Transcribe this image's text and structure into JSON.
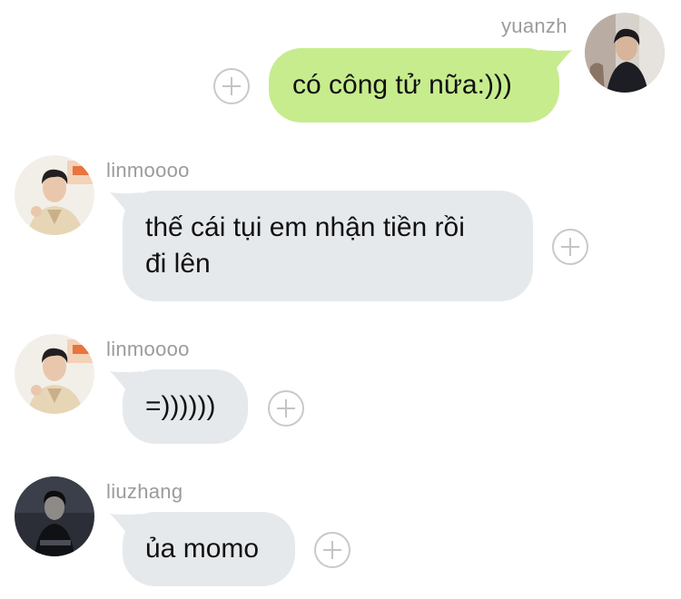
{
  "messages": [
    {
      "sender": "yuanzh",
      "text": "có công tử nữa:)))",
      "side": "right",
      "avatar": "avatar-yuanzh"
    },
    {
      "sender": "linmoooo",
      "text_line1": "thế cái tụi em nhận tiền rồi",
      "text_line2": "đi lên",
      "side": "left",
      "avatar": "avatar-linmoooo"
    },
    {
      "sender": "linmoooo",
      "text": "=))))))",
      "side": "left",
      "avatar": "avatar-linmoooo"
    },
    {
      "sender": "liuzhang",
      "text": "ủa momo",
      "side": "left",
      "avatar": "avatar-liuzhang"
    }
  ],
  "icons": {
    "react": "plus-circle-icon"
  },
  "colors": {
    "outgoing_bubble": "#c7ec8e",
    "incoming_bubble": "#e6e9ec",
    "username": "#9b9b9b",
    "react_icon": "#c4c4c4"
  }
}
